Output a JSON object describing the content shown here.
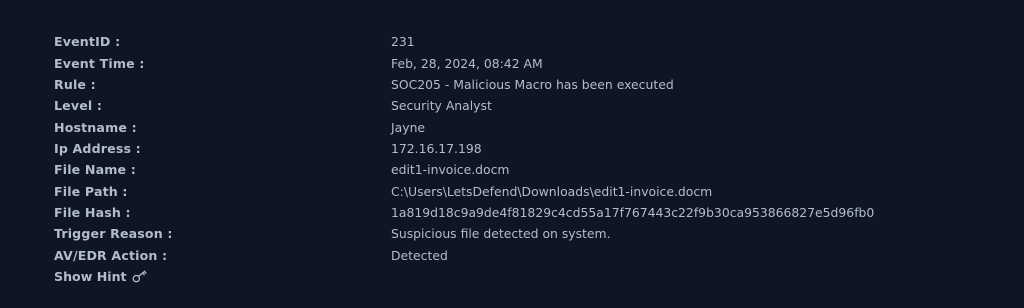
{
  "fields": [
    {
      "label": "EventID :",
      "value": "231"
    },
    {
      "label": "Event Time :",
      "value": "Feb, 28, 2024, 08:42 AM"
    },
    {
      "label": "Rule :",
      "value": "SOC205 - Malicious Macro has been executed"
    },
    {
      "label": "Level :",
      "value": "Security Analyst"
    },
    {
      "label": "Hostname :",
      "value": "Jayne"
    },
    {
      "label": "Ip Address :",
      "value": "172.16.17.198"
    },
    {
      "label": "File Name :",
      "value": "edit1-invoice.docm"
    },
    {
      "label": "File Path :",
      "value": "C:\\Users\\LetsDefend\\Downloads\\edit1-invoice.docm"
    },
    {
      "label": "File Hash :",
      "value": "1a819d18c9a9de4f81829c4cd55a17f767443c22f9b30ca953866827e5d96fb0"
    },
    {
      "label": "Trigger Reason :",
      "value": "Suspicious file detected on system."
    },
    {
      "label": "AV/EDR Action :",
      "value": "Detected"
    }
  ],
  "hint": {
    "label": "Show Hint",
    "icon": "key-icon"
  },
  "colors": {
    "background": "#0f1623",
    "text": "#b3bccd"
  }
}
